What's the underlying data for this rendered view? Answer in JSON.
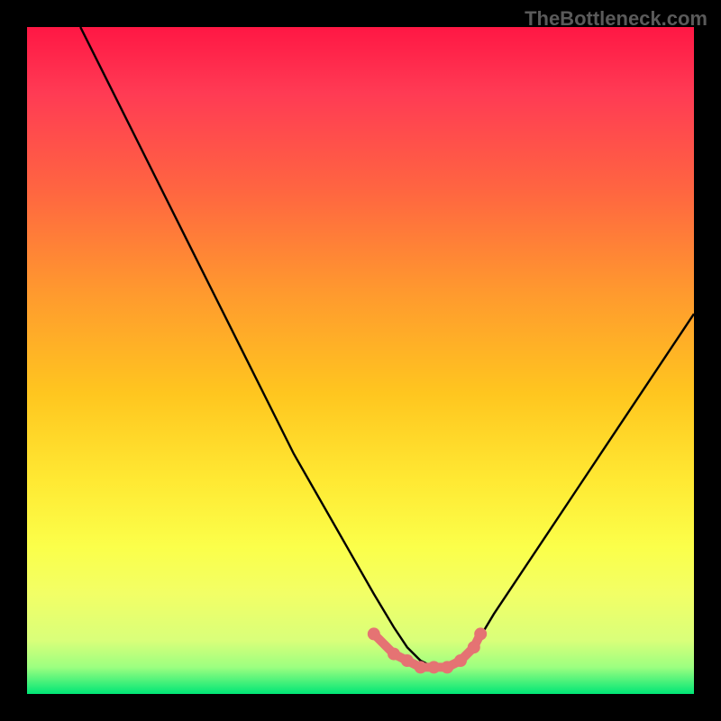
{
  "watermark": "TheBottleneck.com",
  "chart_data": {
    "type": "line",
    "title": "",
    "xlabel": "",
    "ylabel": "",
    "xlim": [
      0,
      100
    ],
    "ylim": [
      0,
      100
    ],
    "grid": false,
    "series": [
      {
        "name": "bottleneck-curve",
        "x": [
          8,
          12,
          16,
          20,
          24,
          28,
          32,
          36,
          40,
          44,
          48,
          52,
          55,
          57,
          59,
          61,
          63,
          65,
          67,
          70,
          74,
          78,
          82,
          86,
          90,
          94,
          98,
          100
        ],
        "y": [
          100,
          92,
          84,
          76,
          68,
          60,
          52,
          44,
          36,
          29,
          22,
          15,
          10,
          7,
          5,
          4,
          4,
          5,
          7,
          12,
          18,
          24,
          30,
          36,
          42,
          48,
          54,
          57
        ]
      }
    ],
    "marker_region": {
      "name": "optimal-range",
      "x": [
        52,
        55,
        57,
        59,
        61,
        63,
        65,
        67,
        68
      ],
      "y": [
        9,
        6,
        5,
        4,
        4,
        4,
        5,
        7,
        9
      ]
    },
    "gradient_stops": [
      {
        "pos": 0.0,
        "color": "#ff1744"
      },
      {
        "pos": 0.1,
        "color": "#ff3b54"
      },
      {
        "pos": 0.25,
        "color": "#ff6740"
      },
      {
        "pos": 0.4,
        "color": "#ff9a2e"
      },
      {
        "pos": 0.55,
        "color": "#ffc61f"
      },
      {
        "pos": 0.68,
        "color": "#ffe933"
      },
      {
        "pos": 0.78,
        "color": "#fbff4a"
      },
      {
        "pos": 0.85,
        "color": "#f2ff66"
      },
      {
        "pos": 0.92,
        "color": "#d9ff7a"
      },
      {
        "pos": 0.96,
        "color": "#9cff80"
      },
      {
        "pos": 1.0,
        "color": "#00e676"
      }
    ],
    "curve_color": "#000000",
    "marker_color": "#e57373"
  }
}
